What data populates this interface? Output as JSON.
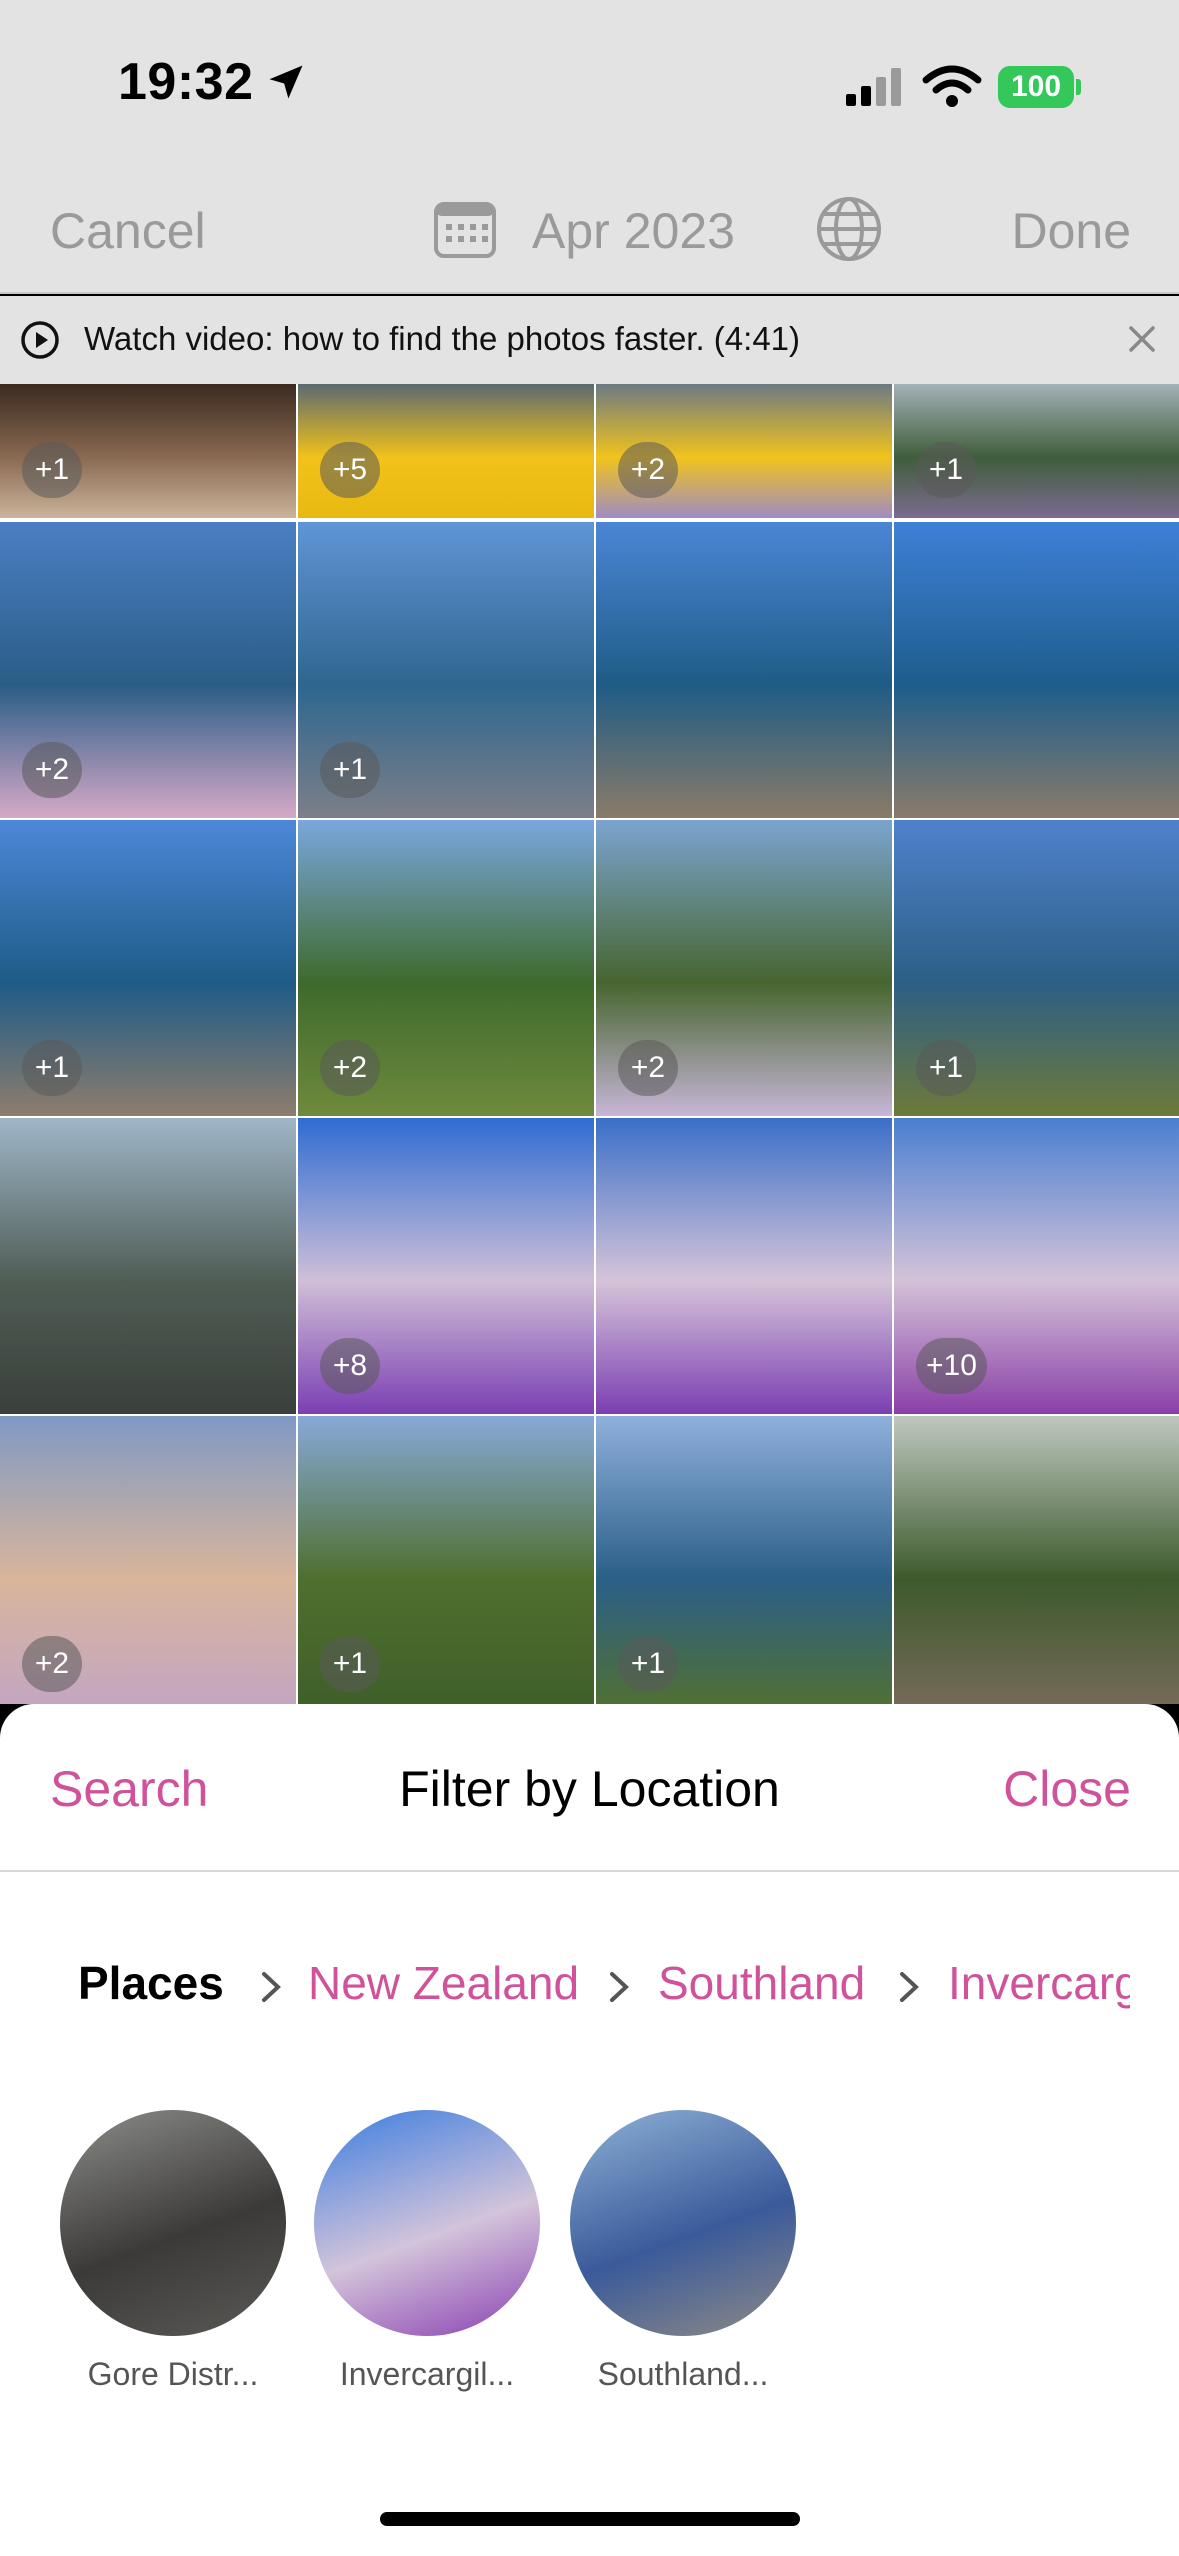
{
  "status_bar": {
    "time": "19:32",
    "battery": "100"
  },
  "nav": {
    "cancel": "Cancel",
    "date": "Apr 2023",
    "done": "Done"
  },
  "banner": {
    "text": "Watch video: how to find the photos faster. (4:41)"
  },
  "grid": {
    "tiles": [
      {
        "badge": "+1",
        "palette": [
          "#3b2a20",
          "#8a6a52",
          "#c9b49a"
        ]
      },
      {
        "badge": "+5",
        "palette": [
          "#5b6a70",
          "#f2c21a",
          "#e8b910"
        ]
      },
      {
        "badge": "+2",
        "palette": [
          "#6c7a84",
          "#f1c31c",
          "#9f8cc4"
        ]
      },
      {
        "badge": "+1",
        "palette": [
          "#a4b1b7",
          "#3f5e3a",
          "#7d6a92"
        ]
      },
      {
        "badge": "+2",
        "palette": [
          "#4a7fc4",
          "#2a5d86",
          "#d6a9c8"
        ]
      },
      {
        "badge": "+1",
        "palette": [
          "#5f95d6",
          "#2e6690",
          "#7d7f88"
        ]
      },
      {
        "badge": "",
        "palette": [
          "#4b86d6",
          "#1e5c86",
          "#8b7b68"
        ]
      },
      {
        "badge": "",
        "palette": [
          "#3f80d8",
          "#1d5d8c",
          "#8a7b6b"
        ]
      },
      {
        "badge": "+1",
        "palette": [
          "#4c88d8",
          "#1e5b87",
          "#8e7d6c"
        ]
      },
      {
        "badge": "+2",
        "palette": [
          "#7aa7dd",
          "#3e6a2d",
          "#6f8a3c"
        ]
      },
      {
        "badge": "+2",
        "palette": [
          "#7aa4d0",
          "#47652f",
          "#c8b6d8"
        ]
      },
      {
        "badge": "+1",
        "palette": [
          "#4e82cc",
          "#2c5f85",
          "#6e7a3a"
        ]
      },
      {
        "badge": "",
        "palette": [
          "#9fb6c8",
          "#4f5d55",
          "#3a3f3a"
        ]
      },
      {
        "badge": "+8",
        "palette": [
          "#2f6cd2",
          "#cfbfd8",
          "#7b3fb2"
        ]
      },
      {
        "badge": "",
        "palette": [
          "#3a6fc8",
          "#d6c4d9",
          "#7b3fb2"
        ]
      },
      {
        "badge": "+10",
        "palette": [
          "#4a7fd0",
          "#d4c2d8",
          "#8a3fa8"
        ]
      },
      {
        "badge": "+2",
        "palette": [
          "#7f99c4",
          "#d9b59b",
          "#c2a5c4"
        ]
      },
      {
        "badge": "+1",
        "palette": [
          "#88a9d8",
          "#4e6f2e",
          "#3f5f2a"
        ]
      },
      {
        "badge": "+1",
        "palette": [
          "#8fb0dc",
          "#2b5f88",
          "#52712f"
        ]
      },
      {
        "badge": "",
        "palette": [
          "#bfc8c0",
          "#3d5a2c",
          "#786a5a"
        ]
      }
    ]
  },
  "sheet": {
    "search": "Search",
    "title": "Filter by Location",
    "close": "Close",
    "breadcrumbs": [
      "Places",
      "New Zealand",
      "Southland",
      "Invercarg"
    ],
    "places": [
      {
        "label": "Gore Distr...",
        "palette": [
          "#8c8d8a",
          "#3c3a38",
          "#5a5956"
        ]
      },
      {
        "label": "Invercargil...",
        "palette": [
          "#3b7de0",
          "#d3c4da",
          "#8a3fb2"
        ]
      },
      {
        "label": "Southland...",
        "palette": [
          "#8fb2d6",
          "#3a5a9a",
          "#8e8a86"
        ]
      }
    ]
  },
  "colors": {
    "accent": "#d0529a",
    "bar_bg": "#e3e3e3",
    "disabled_text": "#9a9a9a",
    "battery": "#34c759"
  }
}
